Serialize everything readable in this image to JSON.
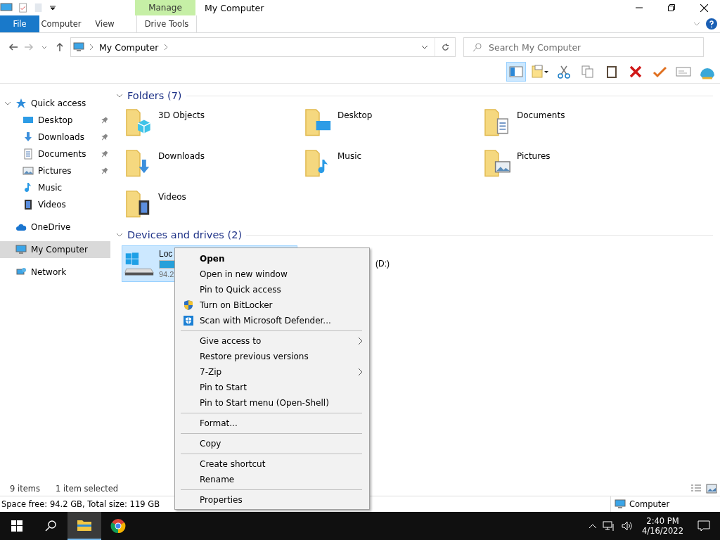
{
  "window": {
    "title": "My Computer",
    "context_label": "Manage"
  },
  "ribbon_tabs": [
    {
      "label": "File",
      "kind": "file",
      "selected": false
    },
    {
      "label": "Computer",
      "kind": "tab",
      "selected": false
    },
    {
      "label": "View",
      "kind": "tab",
      "selected": false
    },
    {
      "label": "Drive Tools",
      "kind": "context",
      "selected": false
    }
  ],
  "address": {
    "path": "My Computer"
  },
  "search": {
    "placeholder": "Search My Computer"
  },
  "sidebar": {
    "items": [
      {
        "label": "Quick access",
        "kind": "star",
        "selected": false,
        "expanded": true,
        "children": [
          {
            "label": "Desktop",
            "kind": "desktop",
            "pinned": true,
            "selected": false
          },
          {
            "label": "Downloads",
            "kind": "download",
            "pinned": true,
            "selected": false
          },
          {
            "label": "Documents",
            "kind": "document",
            "pinned": true,
            "selected": false
          },
          {
            "label": "Pictures",
            "kind": "picture",
            "pinned": true,
            "selected": false
          },
          {
            "label": "Music",
            "kind": "music",
            "pinned": false,
            "selected": false
          },
          {
            "label": "Videos",
            "kind": "video",
            "pinned": false,
            "selected": false
          }
        ]
      },
      {
        "label": "OneDrive",
        "kind": "cloud",
        "selected": false
      },
      {
        "label": "My Computer",
        "kind": "computer",
        "selected": true
      },
      {
        "label": "Network",
        "kind": "network",
        "selected": false
      }
    ]
  },
  "folders": {
    "title": "Folders (7)",
    "expanded": true,
    "items": [
      {
        "label": "3D Objects",
        "kind": "cube"
      },
      {
        "label": "Desktop",
        "kind": "desktop"
      },
      {
        "label": "Documents",
        "kind": "document"
      },
      {
        "label": "Downloads",
        "kind": "download"
      },
      {
        "label": "Music",
        "kind": "music"
      },
      {
        "label": "Pictures",
        "kind": "picture"
      },
      {
        "label": "Videos",
        "kind": "video"
      }
    ]
  },
  "drives": {
    "title": "Devices and drives (2)",
    "expanded": true,
    "items": [
      {
        "label": "Loc",
        "detail": "94.2",
        "level": 0.21,
        "selected": true,
        "kind": "system"
      },
      {
        "label": "(D:)",
        "selected": false,
        "kind": "dvd"
      }
    ]
  },
  "context_menu": {
    "groups": [
      [
        {
          "label": "Open",
          "default": true
        },
        {
          "label": "Open in new window"
        },
        {
          "label": "Pin to Quick access"
        },
        {
          "label": "Turn on BitLocker",
          "kind": "shield"
        },
        {
          "label": "Scan with Microsoft Defender...",
          "kind": "defender"
        }
      ],
      [
        {
          "label": "Give access to",
          "submenu": true
        },
        {
          "label": "Restore previous versions"
        },
        {
          "label": "7-Zip",
          "submenu": true
        },
        {
          "label": "Pin to Start"
        },
        {
          "label": "Pin to Start menu (Open-Shell)"
        }
      ],
      [
        {
          "label": "Format..."
        }
      ],
      [
        {
          "label": "Copy"
        }
      ],
      [
        {
          "label": "Create shortcut"
        },
        {
          "label": "Rename"
        }
      ],
      [
        {
          "label": "Properties"
        }
      ]
    ]
  },
  "status_bar": {
    "count": "9 items",
    "selection": "1 item selected"
  },
  "info_bar": {
    "space": "Space free: 94.2 GB, Total size: 119 GB",
    "location": "Computer"
  },
  "taskbar": {
    "apps": [
      {
        "kind": "explorer",
        "selected": true
      },
      {
        "kind": "chrome",
        "selected": false
      }
    ],
    "time": "2:40 PM",
    "date": "4/16/2022"
  }
}
